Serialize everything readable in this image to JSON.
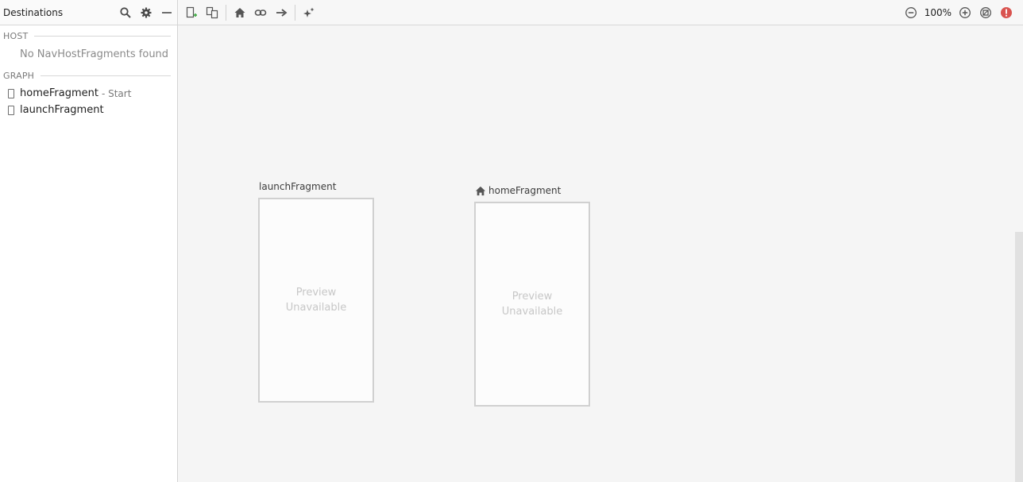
{
  "destinations_panel": {
    "title": "Destinations",
    "icons": [
      "search-icon",
      "gear-icon",
      "minimize-icon"
    ],
    "host_section": {
      "label": "HOST",
      "empty_message": "No NavHostFragments found"
    },
    "graph_section": {
      "label": "GRAPH",
      "items": [
        {
          "name": "homeFragment",
          "suffix": "- Start"
        },
        {
          "name": "launchFragment",
          "suffix": ""
        }
      ]
    }
  },
  "toolbar": {
    "buttons": [
      "new-destination-icon",
      "nested-graph-icon",
      "assign-start-icon",
      "deep-link-icon",
      "add-action-icon",
      "auto-arrange-icon"
    ],
    "zoom_level": "100%",
    "right_icons": [
      "zoom-out-icon",
      "zoom-in-icon",
      "zoom-fit-icon",
      "error-icon"
    ]
  },
  "canvas": {
    "fragments": [
      {
        "name": "launchFragment",
        "is_start": false,
        "preview": "Preview\nUnavailable"
      },
      {
        "name": "homeFragment",
        "is_start": true,
        "preview": "Preview\nUnavailable"
      }
    ]
  },
  "colors": {
    "error": "#d9534f",
    "add_green": "#4caf50",
    "panel_bg": "#ffffff",
    "canvas_bg": "#f5f5f5"
  }
}
